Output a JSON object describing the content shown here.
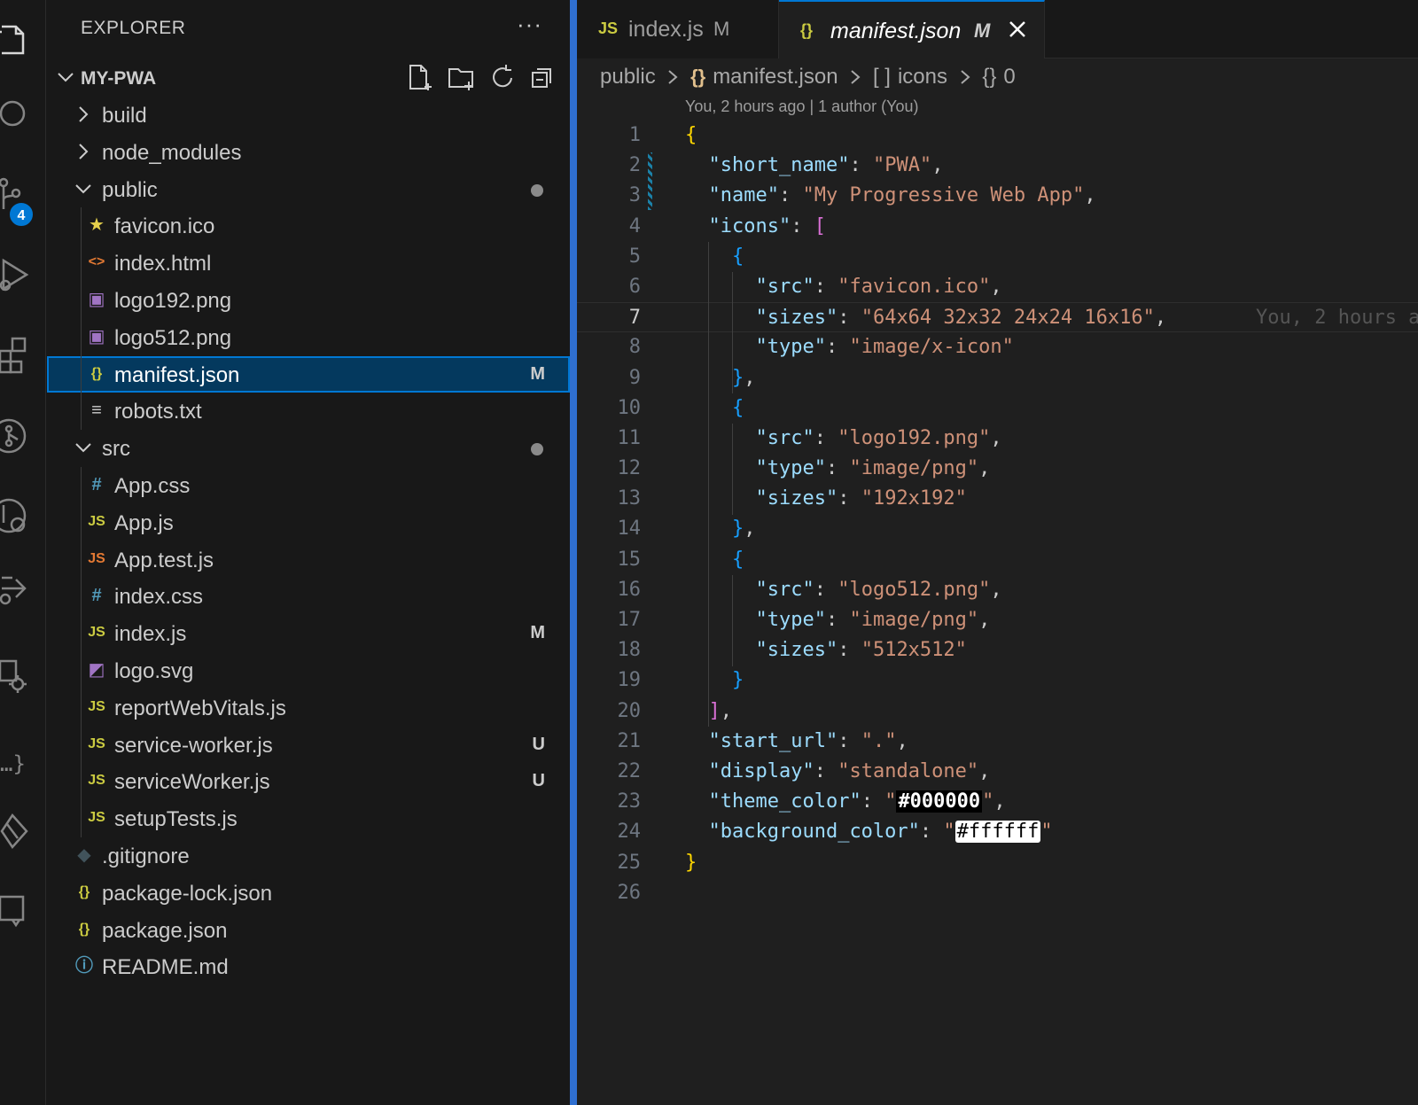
{
  "activity_bar": {
    "scm_badge": "4",
    "icons": [
      "explorer-icon",
      "search-icon",
      "source-control-icon",
      "run-debug-icon",
      "extensions-icon",
      "git-graph-icon",
      "timeline-icon",
      "remote-icon",
      "settings-sync-icon",
      "json-icon",
      "git-icon",
      "remote-explorer-icon"
    ],
    "extra_glyph": "…}"
  },
  "explorer": {
    "title": "EXPLORER",
    "more": "···",
    "project": "MY-PWA",
    "items": [
      {
        "name": "build",
        "type": "folder",
        "expanded": false,
        "status": ""
      },
      {
        "name": "node_modules",
        "type": "folder",
        "expanded": false,
        "status": ""
      },
      {
        "name": "public",
        "type": "folder",
        "expanded": true,
        "status": "dot"
      },
      {
        "name": "favicon.ico",
        "type": "ico",
        "status": ""
      },
      {
        "name": "index.html",
        "type": "html",
        "status": ""
      },
      {
        "name": "logo192.png",
        "type": "image",
        "status": ""
      },
      {
        "name": "logo512.png",
        "type": "image",
        "status": ""
      },
      {
        "name": "manifest.json",
        "type": "json",
        "status": "M",
        "selected": true
      },
      {
        "name": "robots.txt",
        "type": "text",
        "status": ""
      },
      {
        "name": "src",
        "type": "folder",
        "expanded": true,
        "status": "dot"
      },
      {
        "name": "App.css",
        "type": "css",
        "status": ""
      },
      {
        "name": "App.js",
        "type": "js",
        "status": ""
      },
      {
        "name": "App.test.js",
        "type": "test",
        "status": ""
      },
      {
        "name": "index.css",
        "type": "css",
        "status": ""
      },
      {
        "name": "index.js",
        "type": "js",
        "status": "M"
      },
      {
        "name": "logo.svg",
        "type": "svg",
        "status": ""
      },
      {
        "name": "reportWebVitals.js",
        "type": "js",
        "status": ""
      },
      {
        "name": "service-worker.js",
        "type": "js",
        "status": "U"
      },
      {
        "name": "serviceWorker.js",
        "type": "js",
        "status": "U"
      },
      {
        "name": "setupTests.js",
        "type": "js",
        "status": ""
      },
      {
        "name": ".gitignore",
        "type": "git",
        "status": ""
      },
      {
        "name": "package-lock.json",
        "type": "json",
        "status": ""
      },
      {
        "name": "package.json",
        "type": "json",
        "status": ""
      },
      {
        "name": "README.md",
        "type": "info",
        "status": ""
      }
    ]
  },
  "tabs": [
    {
      "icon": "JS",
      "name": "index.js",
      "modified": "M",
      "active": false
    },
    {
      "icon": "{}",
      "name": "manifest.json",
      "modified": "M",
      "active": true
    }
  ],
  "breadcrumbs": {
    "folder": "public",
    "file_icon": "{}",
    "file": "manifest.json",
    "array_icon": "[ ]",
    "array": "icons",
    "object_icon": "{}",
    "object": "0"
  },
  "blame": {
    "header": "You, 2 hours ago | 1 author (You)",
    "inline": "You, 2 hours a"
  },
  "code": {
    "current_line": 7,
    "line_count": 26,
    "lines": [
      "{",
      "  \"short_name\": \"PWA\",",
      "  \"name\": \"My Progressive Web App\",",
      "  \"icons\": [",
      "    {",
      "      \"src\": \"favicon.ico\",",
      "      \"sizes\": \"64x64 32x32 24x24 16x16\",",
      "      \"type\": \"image/x-icon\"",
      "    },",
      "    {",
      "      \"src\": \"logo192.png\",",
      "      \"type\": \"image/png\",",
      "      \"sizes\": \"192x192\"",
      "    },",
      "    {",
      "      \"src\": \"logo512.png\",",
      "      \"type\": \"image/png\",",
      "      \"sizes\": \"512x512\"",
      "    }",
      "  ],",
      "  \"start_url\": \".\",",
      "  \"display\": \"standalone\",",
      "  \"theme_color\": \"#000000\",",
      "  \"background_color\": \"#ffffff\"",
      "}",
      ""
    ]
  },
  "colors": {
    "accent": "#0078d4",
    "splitter": "#2f6fd0",
    "json_key": "#9cdcfe",
    "json_string": "#ce9178",
    "bracket_1": "#ffd700",
    "bracket_2": "#da70d6",
    "bracket_3": "#179fff",
    "theme_color_swatch": "#000000",
    "background_color_swatch": "#ffffff"
  }
}
